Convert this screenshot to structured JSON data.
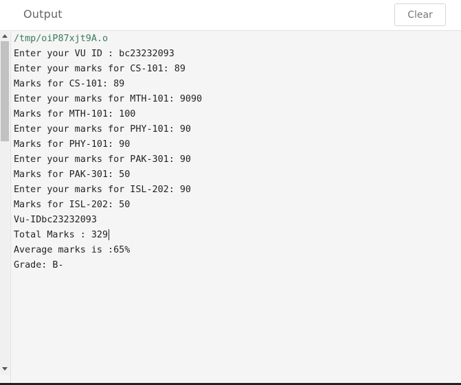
{
  "header": {
    "title": "Output",
    "clear_label": "Clear"
  },
  "output": {
    "lines": [
      "/tmp/oiP87xjt9A.o",
      "Enter your VU ID : bc23232093",
      "Enter your marks for CS-101: 89",
      "Marks for CS-101: 89",
      "Enter your marks for MTH-101: 9090",
      "Marks for MTH-101: 100",
      "Enter your marks for PHY-101: 90",
      "Marks for PHY-101: 90",
      "Enter your marks for PAK-301: 90",
      "Marks for PAK-301: 50",
      "Enter your marks for ISL-202: 90",
      "Marks for ISL-202: 50",
      "Vu-IDbc23232093",
      "Total Marks : 329",
      "Average marks is :65%",
      "Grade: B-"
    ]
  }
}
